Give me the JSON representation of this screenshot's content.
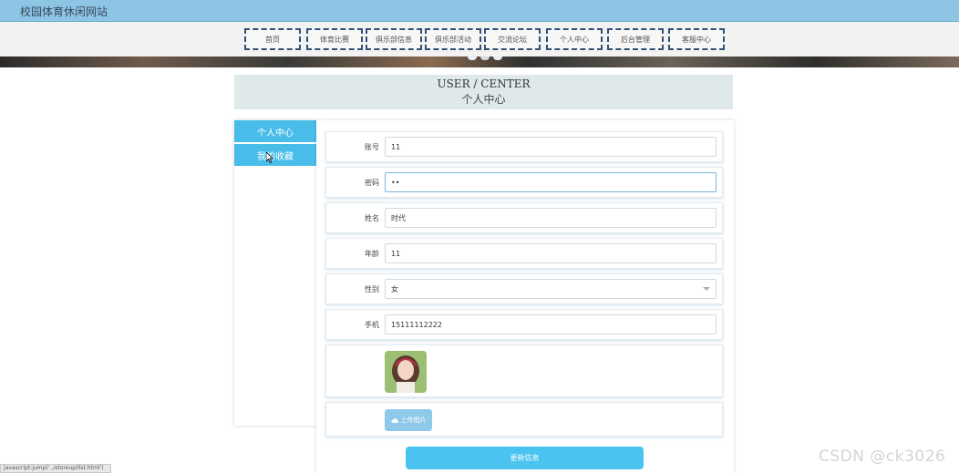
{
  "site": {
    "title": "校园体育休闲网站"
  },
  "nav": {
    "items": [
      "首页",
      "体育比赛",
      "俱乐部信息",
      "俱乐部活动",
      "交流论坛",
      "个人中心",
      "后台管理",
      "客服中心"
    ]
  },
  "heading": {
    "en": "USER / CENTER",
    "cn": "个人中心"
  },
  "sidebar": {
    "items": [
      "个人中心",
      "我的收藏"
    ]
  },
  "form": {
    "account": {
      "label": "账号",
      "value": "11"
    },
    "password": {
      "label": "密码",
      "value": "••"
    },
    "name": {
      "label": "姓名",
      "value": "时代"
    },
    "age": {
      "label": "年龄",
      "value": "11"
    },
    "gender": {
      "label": "性别",
      "value": "女"
    },
    "phone": {
      "label": "手机",
      "value": "15111112222"
    },
    "upload_label": "上传图片",
    "submit_label": "更新信息"
  },
  "status_url": "javascript:jump('../storeup/list.html')",
  "watermark": "CSDN @ck3026",
  "colors": {
    "topbar": "#8ec5e4",
    "accent": "#49bde9",
    "nav_border": "#31507a"
  }
}
